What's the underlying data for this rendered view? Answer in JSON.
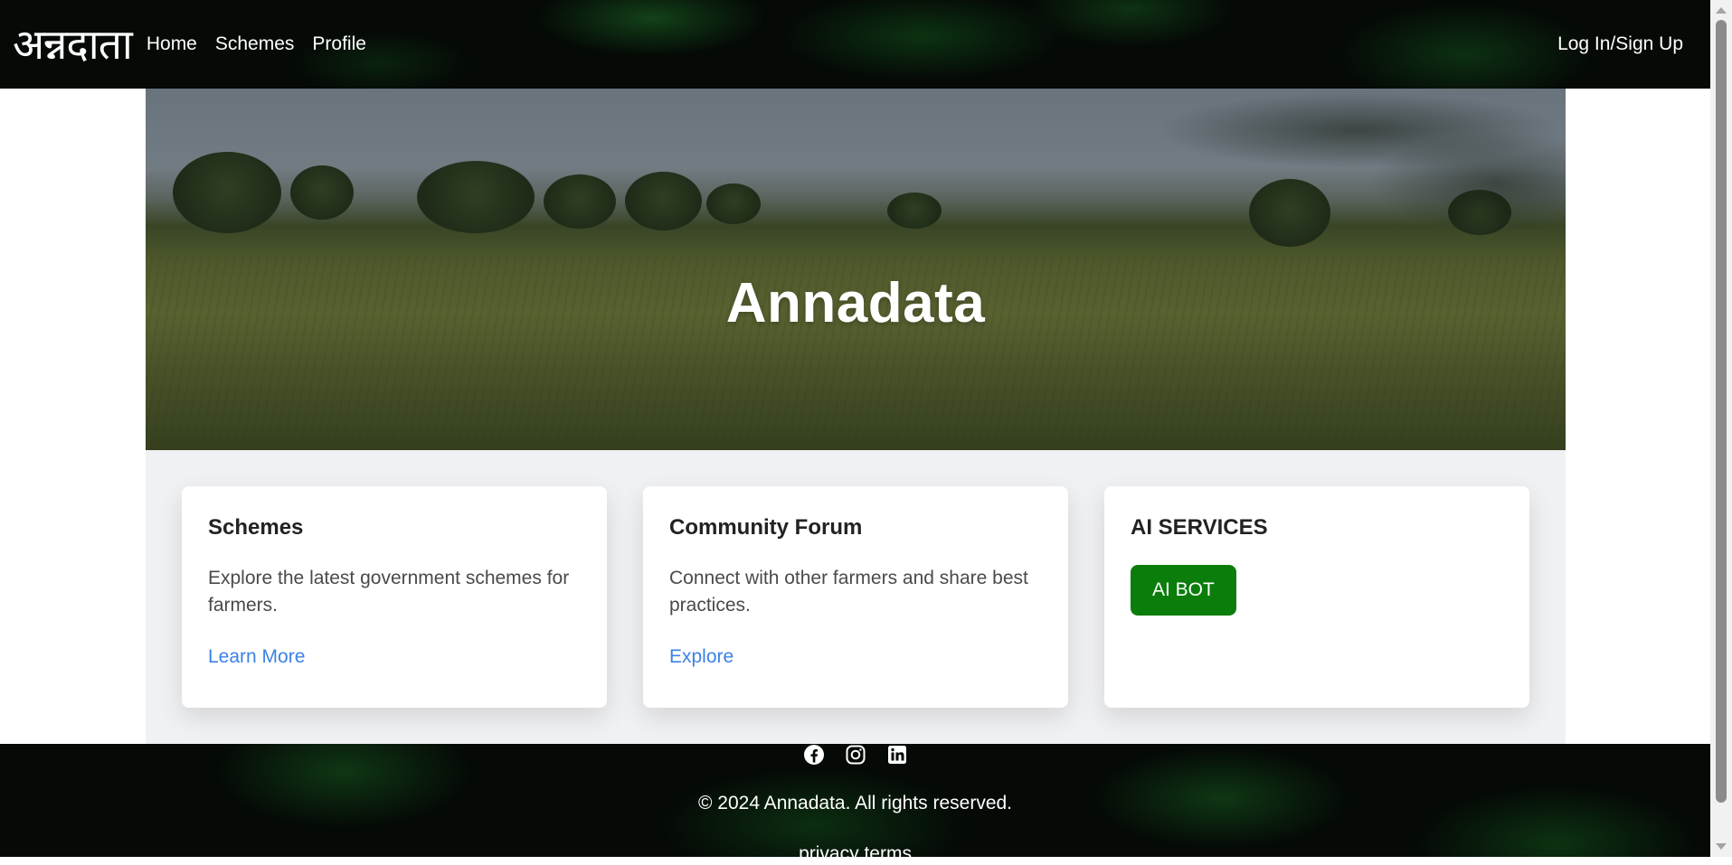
{
  "navbar": {
    "logo": "अन्नदाता",
    "links": [
      "Home",
      "Schemes",
      "Profile"
    ],
    "login": "Log In/Sign Up"
  },
  "hero": {
    "title": "Annadata"
  },
  "cards": [
    {
      "title": "Schemes",
      "text": "Explore the latest government schemes for farmers.",
      "link": "Learn More"
    },
    {
      "title": "Community Forum",
      "text": "Connect with other farmers and share best practices.",
      "link": "Explore"
    },
    {
      "title": "AI SERVICES",
      "button": "AI BOT"
    }
  ],
  "footer": {
    "social_icons": [
      "facebook-icon",
      "instagram-icon",
      "linkedin-icon"
    ],
    "copyright": "© 2024 Annadata. All rights reserved.",
    "links": [
      "privacy",
      "terms"
    ]
  },
  "colors": {
    "accent_button": "#0a7d0a",
    "link": "#3b82e6",
    "nav_bg": "#050a06"
  }
}
